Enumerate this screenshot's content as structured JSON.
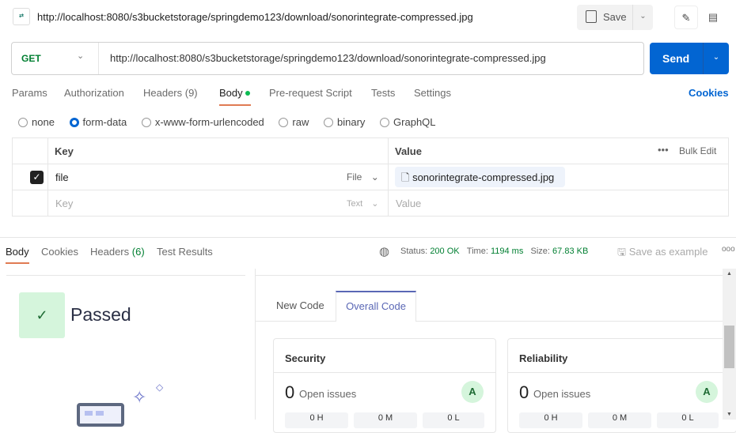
{
  "header": {
    "title": "http://localhost:8080/s3bucketstorage/springdemo123/download/sonorintegrate-compressed.jpg",
    "save_label": "Save"
  },
  "request": {
    "method": "GET",
    "url": "http://localhost:8080/s3bucketstorage/springdemo123/download/sonorintegrate-compressed.jpg",
    "send_label": "Send"
  },
  "tabs": [
    "Params",
    "Authorization",
    "Headers (9)",
    "Body",
    "Pre-request Script",
    "Tests",
    "Settings"
  ],
  "cookies_link": "Cookies",
  "body_types": [
    "none",
    "form-data",
    "x-www-form-urlencoded",
    "raw",
    "binary",
    "GraphQL"
  ],
  "body_type_selected": "form-data",
  "table": {
    "key_header": "Key",
    "value_header": "Value",
    "bulk_edit": "Bulk Edit",
    "rows": [
      {
        "checked": true,
        "key": "file",
        "type": "File",
        "value": "sonorintegrate-compressed.jpg"
      }
    ],
    "placeholder": {
      "key": "Key",
      "type": "Text",
      "value": "Value"
    }
  },
  "response": {
    "tabs": [
      "Body",
      "Cookies",
      "Headers",
      "Test Results"
    ],
    "headers_count": "(6)",
    "status_label": "Status:",
    "status": "200 OK",
    "time_label": "Time:",
    "time": "1194 ms",
    "size_label": "Size:",
    "size": "67.83 KB",
    "save_example": "Save as example"
  },
  "quality": {
    "status": "Passed",
    "tabs": [
      "New Code",
      "Overall Code"
    ],
    "active_tab": "Overall Code",
    "cards": [
      {
        "title": "Security",
        "count": "0",
        "label": "Open issues",
        "grade": "A",
        "levels": [
          "0 H",
          "0 M",
          "0 L"
        ]
      },
      {
        "title": "Reliability",
        "count": "0",
        "label": "Open issues",
        "grade": "A",
        "levels": [
          "0 H",
          "0 M",
          "0 L"
        ]
      }
    ]
  },
  "colors": {
    "accent": "#0265d2",
    "passed_bg": "#d5f5dc",
    "status_green": "#007f31",
    "active_tab": "#5a67b5"
  }
}
